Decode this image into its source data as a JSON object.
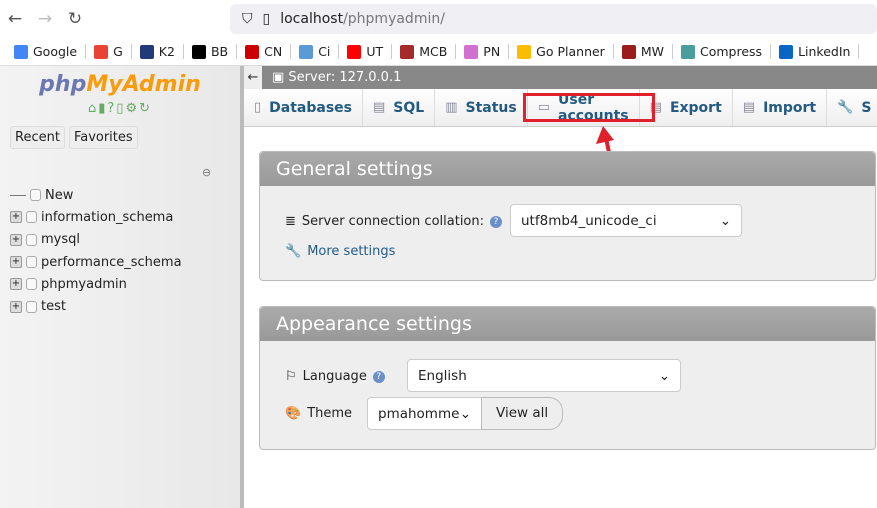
{
  "browser": {
    "url_host": "localhost",
    "url_path": "/phpmyadmin/"
  },
  "bookmarks": [
    {
      "label": "Google",
      "color": "#4285f4"
    },
    {
      "label": "G",
      "color": "#ea4335"
    },
    {
      "label": "K2",
      "color": "#223a7a"
    },
    {
      "label": "BB",
      "color": "#000000"
    },
    {
      "label": "CN",
      "color": "#cc0000"
    },
    {
      "label": "Ci",
      "color": "#5b9bd5"
    },
    {
      "label": "UT",
      "color": "#ff0000"
    },
    {
      "label": "MCB",
      "color": "#a52a2a"
    },
    {
      "label": "PN",
      "color": "#d070d0"
    },
    {
      "label": "Go Planner",
      "color": "#fbbc04"
    },
    {
      "label": "MW",
      "color": "#9b1c1c"
    },
    {
      "label": "Compress",
      "color": "#4a9e9e"
    },
    {
      "label": "LinkedIn",
      "color": "#0a66c2"
    }
  ],
  "sidebar": {
    "logo_a": "php",
    "logo_b": "MyAdmin",
    "recent": "Recent",
    "favorites": "Favorites",
    "tree": [
      {
        "label": "New",
        "new": true
      },
      {
        "label": "information_schema"
      },
      {
        "label": "mysql"
      },
      {
        "label": "performance_schema"
      },
      {
        "label": "phpmyadmin"
      },
      {
        "label": "test"
      }
    ]
  },
  "server": "Server: 127.0.0.1",
  "tabs": [
    {
      "label": "Databases",
      "icon": "database-icon",
      "glyph": "▯"
    },
    {
      "label": "SQL",
      "icon": "sql-icon",
      "glyph": "▤"
    },
    {
      "label": "Status",
      "icon": "status-icon",
      "glyph": "▥"
    },
    {
      "label": "User accounts",
      "icon": "users-icon",
      "glyph": "▭"
    },
    {
      "label": "Export",
      "icon": "export-icon",
      "glyph": "▤"
    },
    {
      "label": "Import",
      "icon": "import-icon",
      "glyph": "▤"
    },
    {
      "label": "S",
      "icon": "settings-icon",
      "glyph": "🔧"
    }
  ],
  "general": {
    "title": "General settings",
    "collation_label": "Server connection collation:",
    "collation_value": "utf8mb4_unicode_ci",
    "more": "More settings"
  },
  "appearance": {
    "title": "Appearance settings",
    "language_label": "Language",
    "language_value": "English",
    "theme_label": "Theme",
    "theme_value": "pmahomme",
    "view_all": "View all"
  },
  "annotation_color": "#e0202a"
}
